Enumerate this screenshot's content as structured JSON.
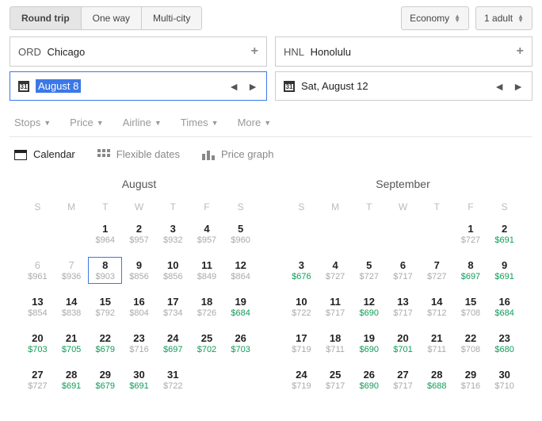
{
  "tripTypes": {
    "round": "Round trip",
    "oneway": "One way",
    "multi": "Multi-city"
  },
  "cabin": "Economy",
  "passengers": "1 adult",
  "origin": {
    "code": "ORD",
    "city": "Chicago"
  },
  "destination": {
    "code": "HNL",
    "city": "Honolulu"
  },
  "departDate": "August 8",
  "returnDate": "Sat, August 12",
  "calIconDay": "31",
  "filters": {
    "stops": "Stops",
    "price": "Price",
    "airline": "Airline",
    "times": "Times",
    "more": "More"
  },
  "tabs": {
    "calendar": "Calendar",
    "flexible": "Flexible dates",
    "graph": "Price graph"
  },
  "dow": [
    "S",
    "M",
    "T",
    "W",
    "T",
    "F",
    "S"
  ],
  "months": [
    {
      "name": "August",
      "weeks": [
        [
          {},
          {},
          {
            "d": "1",
            "p": "$964"
          },
          {
            "d": "2",
            "p": "$957"
          },
          {
            "d": "3",
            "p": "$932"
          },
          {
            "d": "4",
            "p": "$957"
          },
          {
            "d": "5",
            "p": "$960"
          }
        ],
        [
          {
            "d": "6",
            "p": "$961",
            "dim": true
          },
          {
            "d": "7",
            "p": "$936",
            "dim": true
          },
          {
            "d": "8",
            "p": "$903",
            "sel": true
          },
          {
            "d": "9",
            "p": "$856"
          },
          {
            "d": "10",
            "p": "$856"
          },
          {
            "d": "11",
            "p": "$849"
          },
          {
            "d": "12",
            "p": "$864"
          }
        ],
        [
          {
            "d": "13",
            "p": "$854"
          },
          {
            "d": "14",
            "p": "$838"
          },
          {
            "d": "15",
            "p": "$792"
          },
          {
            "d": "16",
            "p": "$804"
          },
          {
            "d": "17",
            "p": "$734"
          },
          {
            "d": "18",
            "p": "$726"
          },
          {
            "d": "19",
            "p": "$684",
            "g": true
          }
        ],
        [
          {
            "d": "20",
            "p": "$703",
            "g": true
          },
          {
            "d": "21",
            "p": "$705",
            "g": true
          },
          {
            "d": "22",
            "p": "$679",
            "g": true
          },
          {
            "d": "23",
            "p": "$716"
          },
          {
            "d": "24",
            "p": "$697",
            "g": true
          },
          {
            "d": "25",
            "p": "$702",
            "g": true
          },
          {
            "d": "26",
            "p": "$703",
            "g": true
          }
        ],
        [
          {
            "d": "27",
            "p": "$727"
          },
          {
            "d": "28",
            "p": "$691",
            "g": true
          },
          {
            "d": "29",
            "p": "$679",
            "g": true
          },
          {
            "d": "30",
            "p": "$691",
            "g": true
          },
          {
            "d": "31",
            "p": "$722"
          },
          {},
          {}
        ]
      ]
    },
    {
      "name": "September",
      "weeks": [
        [
          {},
          {},
          {},
          {},
          {},
          {
            "d": "1",
            "p": "$727"
          },
          {
            "d": "2",
            "p": "$691",
            "g": true
          }
        ],
        [
          {
            "d": "3",
            "p": "$676",
            "g": true
          },
          {
            "d": "4",
            "p": "$727"
          },
          {
            "d": "5",
            "p": "$727"
          },
          {
            "d": "6",
            "p": "$717"
          },
          {
            "d": "7",
            "p": "$727"
          },
          {
            "d": "8",
            "p": "$697",
            "g": true
          },
          {
            "d": "9",
            "p": "$691",
            "g": true
          }
        ],
        [
          {
            "d": "10",
            "p": "$722"
          },
          {
            "d": "11",
            "p": "$717"
          },
          {
            "d": "12",
            "p": "$690",
            "g": true
          },
          {
            "d": "13",
            "p": "$717"
          },
          {
            "d": "14",
            "p": "$712"
          },
          {
            "d": "15",
            "p": "$708"
          },
          {
            "d": "16",
            "p": "$684",
            "g": true
          }
        ],
        [
          {
            "d": "17",
            "p": "$719"
          },
          {
            "d": "18",
            "p": "$711"
          },
          {
            "d": "19",
            "p": "$690",
            "g": true
          },
          {
            "d": "20",
            "p": "$701",
            "g": true
          },
          {
            "d": "21",
            "p": "$711"
          },
          {
            "d": "22",
            "p": "$708"
          },
          {
            "d": "23",
            "p": "$680",
            "g": true
          }
        ],
        [
          {
            "d": "24",
            "p": "$719"
          },
          {
            "d": "25",
            "p": "$717"
          },
          {
            "d": "26",
            "p": "$690",
            "g": true
          },
          {
            "d": "27",
            "p": "$717"
          },
          {
            "d": "28",
            "p": "$688",
            "g": true
          },
          {
            "d": "29",
            "p": "$716"
          },
          {
            "d": "30",
            "p": "$710"
          }
        ]
      ]
    }
  ]
}
